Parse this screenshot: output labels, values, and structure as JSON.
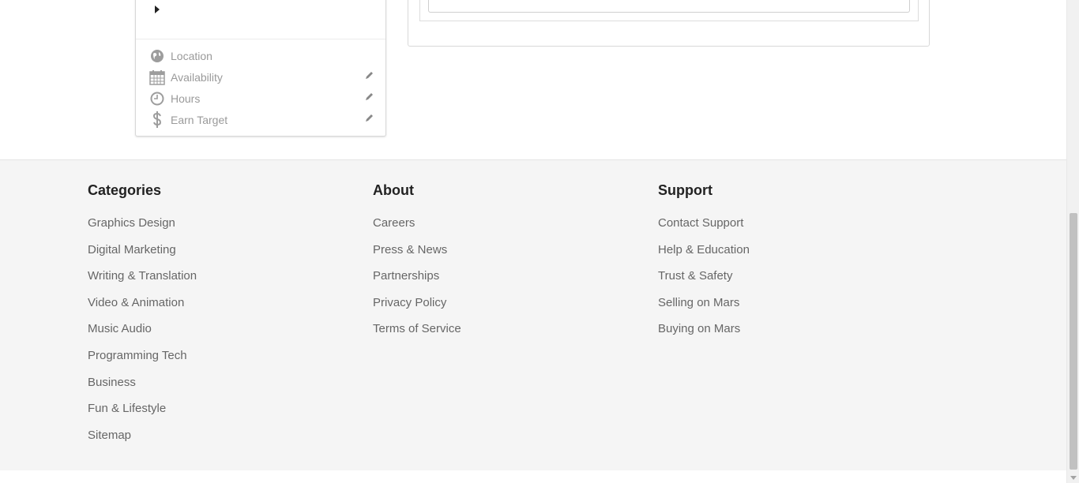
{
  "profile_card": {
    "rows": [
      {
        "label": "Location",
        "icon": "globe-icon"
      },
      {
        "label": "Availability",
        "icon": "calendar-icon"
      },
      {
        "label": "Hours",
        "icon": "clock-icon"
      },
      {
        "label": "Earn Target",
        "icon": "dollar-icon"
      }
    ]
  },
  "footer": {
    "categories": {
      "title": "Categories",
      "items": [
        "Graphics Design",
        "Digital Marketing",
        "Writing & Translation",
        "Video & Animation",
        "Music Audio",
        "Programming Tech",
        "Business",
        "Fun & Lifestyle",
        "Sitemap"
      ]
    },
    "about": {
      "title": "About",
      "items": [
        "Careers",
        "Press & News",
        "Partnerships",
        "Privacy Policy",
        "Terms of Service"
      ]
    },
    "support": {
      "title": "Support",
      "items": [
        "Contact Support",
        "Help & Education",
        "Trust & Safety",
        "Selling on Mars",
        "Buying on Mars"
      ]
    }
  },
  "colors": {
    "footer_bg": "#f5f5f5",
    "link": "#666666",
    "heading": "#222222",
    "muted": "#9a9a9a"
  }
}
